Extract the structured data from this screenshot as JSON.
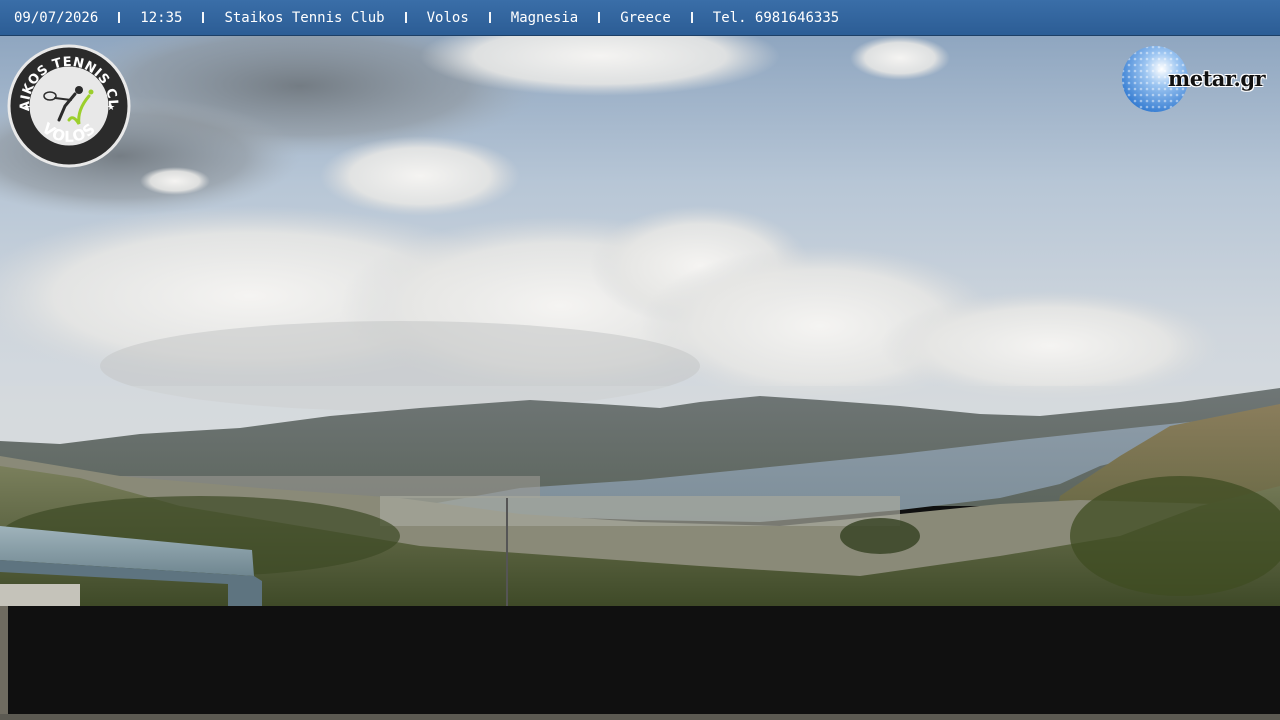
{
  "infobar": {
    "date": "09/07/2026",
    "time": "12:35",
    "club": "Staikos Tennis Club",
    "city": "Volos",
    "region": "Magnesia",
    "country": "Greece",
    "phone": "Tel. 6981646335",
    "background_color": "#2c5d95"
  },
  "club_logo": {
    "top_text": "STAIKOS TENNIS CLUB",
    "bottom_text": "VOLOS",
    "icon": "tennis-player-icon"
  },
  "metar_logo": {
    "text": "metar.gr",
    "icon": "golf-ball-icon"
  }
}
